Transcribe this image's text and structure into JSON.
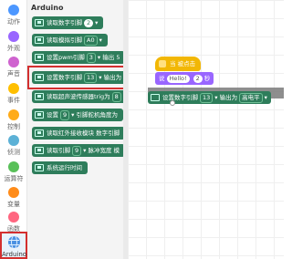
{
  "categories": [
    {
      "label": "动作",
      "color": "#4c97ff"
    },
    {
      "label": "外观",
      "color": "#9966ff"
    },
    {
      "label": "声音",
      "color": "#cf63cf"
    },
    {
      "label": "事件",
      "color": "#ffbf00"
    },
    {
      "label": "控制",
      "color": "#ffab19"
    },
    {
      "label": "侦测",
      "color": "#5cb1d6"
    },
    {
      "label": "运算符",
      "color": "#59c059"
    },
    {
      "label": "变量",
      "color": "#ff8c1a"
    },
    {
      "label": "函数",
      "color": "#ff6680"
    },
    {
      "label": "Arduino",
      "color": "#4a90e2"
    }
  ],
  "flyout": {
    "title": "Arduino",
    "blocks": [
      {
        "text": "读取数字引脚",
        "value": "2"
      },
      {
        "text": "读取模拟引脚",
        "value": "A0"
      },
      {
        "text": "设置pwm引脚",
        "value": "3",
        "suffix": "输出 5"
      },
      {
        "text": "设置数字引脚",
        "value": "13",
        "suffix": "输出为"
      },
      {
        "text": "读取超声波传感器trig为",
        "value": "8"
      },
      {
        "text": "设置",
        "value": "9",
        "suffix": "引脚舵机角度为"
      },
      {
        "text": "读取红外接收模块 数字引脚"
      },
      {
        "text": "读取引脚",
        "value": "9",
        "suffix": "脉冲宽度 模"
      },
      {
        "text": "系统运行时间"
      }
    ]
  },
  "workspace": {
    "hat_label": "当 被点击",
    "say_label": "说",
    "say_text": "Hello!",
    "say_secs": "2",
    "say_unit": "秒",
    "pin_block_label": "设置数字引脚",
    "pin_block_pin": "13",
    "pin_block_mid": "输出为",
    "pin_block_level": "高电平"
  }
}
